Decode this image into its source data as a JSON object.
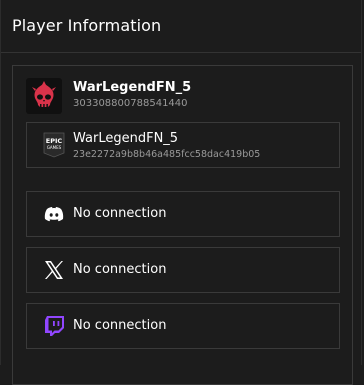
{
  "header": {
    "title": "Player Information"
  },
  "player": {
    "name": "WarLegendFN_5",
    "id": "303308800788541440",
    "avatar_icon": "flaming-skull-icon",
    "avatar_color": "#d9334a"
  },
  "connections": [
    {
      "service": "Epic Games",
      "icon": "epic-games-icon",
      "label": "WarLegendFN_5",
      "sub": "23e2272a9b8b46a485fcc58dac419b05"
    },
    {
      "service": "Discord",
      "icon": "discord-icon",
      "label": "No connection"
    },
    {
      "service": "X",
      "icon": "x-icon",
      "label": "No connection"
    },
    {
      "service": "Twitch",
      "icon": "twitch-icon",
      "label": "No connection",
      "color": "#9146ff"
    }
  ],
  "colors": {
    "background": "#1c1c1c",
    "border": "#3a3a3a",
    "muted_text": "#9a9a9a"
  }
}
